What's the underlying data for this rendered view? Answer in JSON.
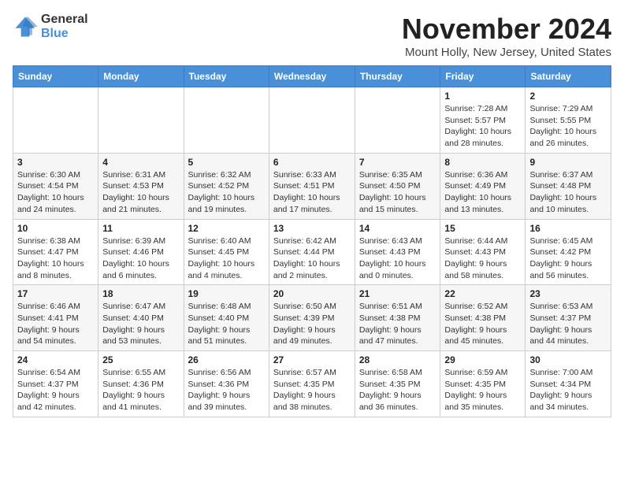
{
  "logo": {
    "general": "General",
    "blue": "Blue"
  },
  "title": "November 2024",
  "location": "Mount Holly, New Jersey, United States",
  "weekdays": [
    "Sunday",
    "Monday",
    "Tuesday",
    "Wednesday",
    "Thursday",
    "Friday",
    "Saturday"
  ],
  "weeks": [
    [
      {
        "day": "",
        "info": ""
      },
      {
        "day": "",
        "info": ""
      },
      {
        "day": "",
        "info": ""
      },
      {
        "day": "",
        "info": ""
      },
      {
        "day": "",
        "info": ""
      },
      {
        "day": "1",
        "info": "Sunrise: 7:28 AM\nSunset: 5:57 PM\nDaylight: 10 hours\nand 28 minutes."
      },
      {
        "day": "2",
        "info": "Sunrise: 7:29 AM\nSunset: 5:55 PM\nDaylight: 10 hours\nand 26 minutes."
      }
    ],
    [
      {
        "day": "3",
        "info": "Sunrise: 6:30 AM\nSunset: 4:54 PM\nDaylight: 10 hours\nand 24 minutes."
      },
      {
        "day": "4",
        "info": "Sunrise: 6:31 AM\nSunset: 4:53 PM\nDaylight: 10 hours\nand 21 minutes."
      },
      {
        "day": "5",
        "info": "Sunrise: 6:32 AM\nSunset: 4:52 PM\nDaylight: 10 hours\nand 19 minutes."
      },
      {
        "day": "6",
        "info": "Sunrise: 6:33 AM\nSunset: 4:51 PM\nDaylight: 10 hours\nand 17 minutes."
      },
      {
        "day": "7",
        "info": "Sunrise: 6:35 AM\nSunset: 4:50 PM\nDaylight: 10 hours\nand 15 minutes."
      },
      {
        "day": "8",
        "info": "Sunrise: 6:36 AM\nSunset: 4:49 PM\nDaylight: 10 hours\nand 13 minutes."
      },
      {
        "day": "9",
        "info": "Sunrise: 6:37 AM\nSunset: 4:48 PM\nDaylight: 10 hours\nand 10 minutes."
      }
    ],
    [
      {
        "day": "10",
        "info": "Sunrise: 6:38 AM\nSunset: 4:47 PM\nDaylight: 10 hours\nand 8 minutes."
      },
      {
        "day": "11",
        "info": "Sunrise: 6:39 AM\nSunset: 4:46 PM\nDaylight: 10 hours\nand 6 minutes."
      },
      {
        "day": "12",
        "info": "Sunrise: 6:40 AM\nSunset: 4:45 PM\nDaylight: 10 hours\nand 4 minutes."
      },
      {
        "day": "13",
        "info": "Sunrise: 6:42 AM\nSunset: 4:44 PM\nDaylight: 10 hours\nand 2 minutes."
      },
      {
        "day": "14",
        "info": "Sunrise: 6:43 AM\nSunset: 4:43 PM\nDaylight: 10 hours\nand 0 minutes."
      },
      {
        "day": "15",
        "info": "Sunrise: 6:44 AM\nSunset: 4:43 PM\nDaylight: 9 hours\nand 58 minutes."
      },
      {
        "day": "16",
        "info": "Sunrise: 6:45 AM\nSunset: 4:42 PM\nDaylight: 9 hours\nand 56 minutes."
      }
    ],
    [
      {
        "day": "17",
        "info": "Sunrise: 6:46 AM\nSunset: 4:41 PM\nDaylight: 9 hours\nand 54 minutes."
      },
      {
        "day": "18",
        "info": "Sunrise: 6:47 AM\nSunset: 4:40 PM\nDaylight: 9 hours\nand 53 minutes."
      },
      {
        "day": "19",
        "info": "Sunrise: 6:48 AM\nSunset: 4:40 PM\nDaylight: 9 hours\nand 51 minutes."
      },
      {
        "day": "20",
        "info": "Sunrise: 6:50 AM\nSunset: 4:39 PM\nDaylight: 9 hours\nand 49 minutes."
      },
      {
        "day": "21",
        "info": "Sunrise: 6:51 AM\nSunset: 4:38 PM\nDaylight: 9 hours\nand 47 minutes."
      },
      {
        "day": "22",
        "info": "Sunrise: 6:52 AM\nSunset: 4:38 PM\nDaylight: 9 hours\nand 45 minutes."
      },
      {
        "day": "23",
        "info": "Sunrise: 6:53 AM\nSunset: 4:37 PM\nDaylight: 9 hours\nand 44 minutes."
      }
    ],
    [
      {
        "day": "24",
        "info": "Sunrise: 6:54 AM\nSunset: 4:37 PM\nDaylight: 9 hours\nand 42 minutes."
      },
      {
        "day": "25",
        "info": "Sunrise: 6:55 AM\nSunset: 4:36 PM\nDaylight: 9 hours\nand 41 minutes."
      },
      {
        "day": "26",
        "info": "Sunrise: 6:56 AM\nSunset: 4:36 PM\nDaylight: 9 hours\nand 39 minutes."
      },
      {
        "day": "27",
        "info": "Sunrise: 6:57 AM\nSunset: 4:35 PM\nDaylight: 9 hours\nand 38 minutes."
      },
      {
        "day": "28",
        "info": "Sunrise: 6:58 AM\nSunset: 4:35 PM\nDaylight: 9 hours\nand 36 minutes."
      },
      {
        "day": "29",
        "info": "Sunrise: 6:59 AM\nSunset: 4:35 PM\nDaylight: 9 hours\nand 35 minutes."
      },
      {
        "day": "30",
        "info": "Sunrise: 7:00 AM\nSunset: 4:34 PM\nDaylight: 9 hours\nand 34 minutes."
      }
    ]
  ]
}
